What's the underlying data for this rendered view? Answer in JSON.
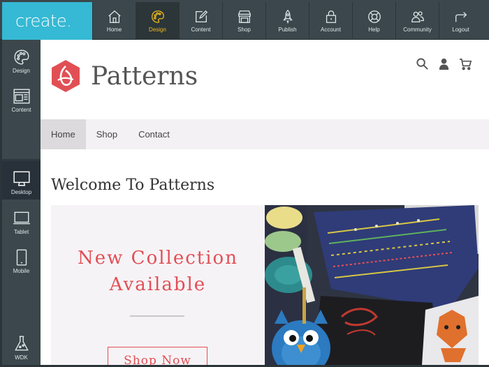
{
  "app": {
    "logo_text": "create."
  },
  "topnav": [
    {
      "id": "home",
      "label": "Home",
      "icon": "home-icon",
      "active": false
    },
    {
      "id": "design",
      "label": "Design",
      "icon": "palette-icon",
      "active": true
    },
    {
      "id": "content",
      "label": "Content",
      "icon": "edit-icon",
      "active": false
    },
    {
      "id": "shop",
      "label": "Shop",
      "icon": "shop-icon",
      "active": false
    },
    {
      "id": "publish",
      "label": "Publish",
      "icon": "rocket-icon",
      "active": false
    },
    {
      "id": "account",
      "label": "Account",
      "icon": "lock-icon",
      "active": false
    },
    {
      "id": "help",
      "label": "Help",
      "icon": "lifebuoy-icon",
      "active": false
    },
    {
      "id": "community",
      "label": "Community",
      "icon": "people-icon",
      "active": false
    },
    {
      "id": "logout",
      "label": "Logout",
      "icon": "logout-icon",
      "active": false
    }
  ],
  "sidebar": {
    "items": [
      {
        "id": "design",
        "label": "Design",
        "icon": "palette-icon"
      },
      {
        "id": "content",
        "label": "Content",
        "icon": "layout-icon"
      },
      {
        "id": "desktop",
        "label": "Desktop",
        "icon": "desktop-icon",
        "active": true
      },
      {
        "id": "tablet",
        "label": "Tablet",
        "icon": "tablet-icon"
      },
      {
        "id": "mobile",
        "label": "Mobile",
        "icon": "mobile-icon"
      },
      {
        "id": "wdk",
        "label": "WDK",
        "icon": "flask-icon"
      }
    ]
  },
  "site": {
    "name": "Patterns",
    "nav": [
      {
        "label": "Home",
        "active": true
      },
      {
        "label": "Shop",
        "active": false
      },
      {
        "label": "Contact",
        "active": false
      }
    ],
    "welcome": "Welcome To Patterns",
    "hero": {
      "title_line1": "New Collection",
      "title_line2": "Available",
      "button": "Shop Now"
    },
    "tools": [
      "search-icon",
      "user-icon",
      "cart-icon"
    ]
  },
  "colors": {
    "accent": "#35b9d4",
    "active_nav": "#f2bc1c",
    "brand_red": "#e14f55",
    "bar": "#3b474c"
  }
}
